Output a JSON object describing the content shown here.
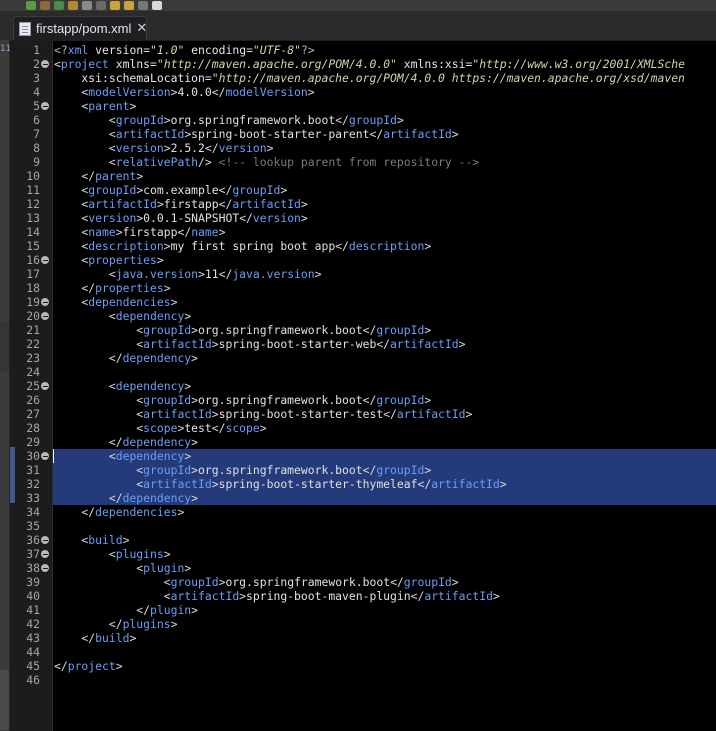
{
  "colors": {
    "editor_bg": "#000000",
    "tag": "#6c9ef5",
    "attr_value": "#cfd6a8",
    "comment": "#7a7a7a",
    "selection": "#253a7b",
    "gutter_bg": "#1c1c1c"
  },
  "tab": {
    "label": "firstapp/pom.xml",
    "close_glyph": "✕",
    "icon": "xml-file-icon"
  },
  "left_strip_mark": "11",
  "editor": {
    "lines": [
      {
        "n": "1",
        "fold": false,
        "sel": false,
        "tokens": [
          [
            "pi",
            "<?"
          ],
          [
            "t",
            "xml"
          ],
          [
            "a",
            " version"
          ],
          [
            "b",
            "="
          ],
          [
            "v",
            "\"1.0\""
          ],
          [
            "a",
            " encoding"
          ],
          [
            "b",
            "="
          ],
          [
            "v",
            "\"UTF-8\""
          ],
          [
            "pi",
            "?>"
          ]
        ]
      },
      {
        "n": "2",
        "fold": true,
        "sel": false,
        "tokens": [
          [
            "b",
            "<"
          ],
          [
            "t",
            "project"
          ],
          [
            "a",
            " xmlns"
          ],
          [
            "b",
            "="
          ],
          [
            "v",
            "\"http://maven.apache.org/POM/4.0.0\""
          ],
          [
            "a",
            " xmlns:xsi"
          ],
          [
            "b",
            "="
          ],
          [
            "v",
            "\"http://www.w3.org/2001/XMLSche"
          ]
        ]
      },
      {
        "n": "3",
        "fold": false,
        "sel": false,
        "tokens": [
          [
            "a",
            "    xsi:schemaLocation"
          ],
          [
            "b",
            "="
          ],
          [
            "v",
            "\"http://maven.apache.org/POM/4.0.0 https://maven.apache.org/xsd/maven"
          ]
        ]
      },
      {
        "n": "4",
        "fold": false,
        "sel": false,
        "tokens": [
          [
            "b",
            "    <"
          ],
          [
            "t",
            "modelVersion"
          ],
          [
            "b",
            ">"
          ],
          [
            "tx",
            "4.0.0"
          ],
          [
            "b",
            "</"
          ],
          [
            "t",
            "modelVersion"
          ],
          [
            "b",
            ">"
          ]
        ]
      },
      {
        "n": "5",
        "fold": true,
        "sel": false,
        "tokens": [
          [
            "b",
            "    <"
          ],
          [
            "t",
            "parent"
          ],
          [
            "b",
            ">"
          ]
        ]
      },
      {
        "n": "6",
        "fold": false,
        "sel": false,
        "tokens": [
          [
            "b",
            "        <"
          ],
          [
            "t",
            "groupId"
          ],
          [
            "b",
            ">"
          ],
          [
            "tx",
            "org.springframework.boot"
          ],
          [
            "b",
            "</"
          ],
          [
            "t",
            "groupId"
          ],
          [
            "b",
            ">"
          ]
        ]
      },
      {
        "n": "7",
        "fold": false,
        "sel": false,
        "tokens": [
          [
            "b",
            "        <"
          ],
          [
            "t",
            "artifactId"
          ],
          [
            "b",
            ">"
          ],
          [
            "tx",
            "spring-boot-starter-parent"
          ],
          [
            "b",
            "</"
          ],
          [
            "t",
            "artifactId"
          ],
          [
            "b",
            ">"
          ]
        ]
      },
      {
        "n": "8",
        "fold": false,
        "sel": false,
        "tokens": [
          [
            "b",
            "        <"
          ],
          [
            "t",
            "version"
          ],
          [
            "b",
            ">"
          ],
          [
            "tx",
            "2.5.2"
          ],
          [
            "b",
            "</"
          ],
          [
            "t",
            "version"
          ],
          [
            "b",
            ">"
          ]
        ]
      },
      {
        "n": "9",
        "fold": false,
        "sel": false,
        "tokens": [
          [
            "b",
            "        <"
          ],
          [
            "t",
            "relativePath"
          ],
          [
            "b",
            "/>"
          ],
          [
            "c",
            " <!-- lookup parent from repository -->"
          ]
        ]
      },
      {
        "n": "10",
        "fold": false,
        "sel": false,
        "tokens": [
          [
            "b",
            "    </"
          ],
          [
            "t",
            "parent"
          ],
          [
            "b",
            ">"
          ]
        ]
      },
      {
        "n": "11",
        "fold": false,
        "sel": false,
        "tokens": [
          [
            "b",
            "    <"
          ],
          [
            "t",
            "groupId"
          ],
          [
            "b",
            ">"
          ],
          [
            "tx",
            "com.example"
          ],
          [
            "b",
            "</"
          ],
          [
            "t",
            "groupId"
          ],
          [
            "b",
            ">"
          ]
        ]
      },
      {
        "n": "12",
        "fold": false,
        "sel": false,
        "tokens": [
          [
            "b",
            "    <"
          ],
          [
            "t",
            "artifactId"
          ],
          [
            "b",
            ">"
          ],
          [
            "tx",
            "firstapp"
          ],
          [
            "b",
            "</"
          ],
          [
            "t",
            "artifactId"
          ],
          [
            "b",
            ">"
          ]
        ]
      },
      {
        "n": "13",
        "fold": false,
        "sel": false,
        "tokens": [
          [
            "b",
            "    <"
          ],
          [
            "t",
            "version"
          ],
          [
            "b",
            ">"
          ],
          [
            "tx",
            "0.0.1-SNAPSHOT"
          ],
          [
            "b",
            "</"
          ],
          [
            "t",
            "version"
          ],
          [
            "b",
            ">"
          ]
        ]
      },
      {
        "n": "14",
        "fold": false,
        "sel": false,
        "tokens": [
          [
            "b",
            "    <"
          ],
          [
            "t",
            "name"
          ],
          [
            "b",
            ">"
          ],
          [
            "tx",
            "firstapp"
          ],
          [
            "b",
            "</"
          ],
          [
            "t",
            "name"
          ],
          [
            "b",
            ">"
          ]
        ]
      },
      {
        "n": "15",
        "fold": false,
        "sel": false,
        "tokens": [
          [
            "b",
            "    <"
          ],
          [
            "t",
            "description"
          ],
          [
            "b",
            ">"
          ],
          [
            "tx",
            "my first spring boot app"
          ],
          [
            "b",
            "</"
          ],
          [
            "t",
            "description"
          ],
          [
            "b",
            ">"
          ]
        ]
      },
      {
        "n": "16",
        "fold": true,
        "sel": false,
        "tokens": [
          [
            "b",
            "    <"
          ],
          [
            "t",
            "properties"
          ],
          [
            "b",
            ">"
          ]
        ]
      },
      {
        "n": "17",
        "fold": false,
        "sel": false,
        "tokens": [
          [
            "b",
            "        <"
          ],
          [
            "t",
            "java.version"
          ],
          [
            "b",
            ">"
          ],
          [
            "tx",
            "11"
          ],
          [
            "b",
            "</"
          ],
          [
            "t",
            "java.version"
          ],
          [
            "b",
            ">"
          ]
        ]
      },
      {
        "n": "18",
        "fold": false,
        "sel": false,
        "tokens": [
          [
            "b",
            "    </"
          ],
          [
            "t",
            "properties"
          ],
          [
            "b",
            ">"
          ]
        ]
      },
      {
        "n": "19",
        "fold": true,
        "sel": false,
        "tokens": [
          [
            "b",
            "    <"
          ],
          [
            "t",
            "dependencies"
          ],
          [
            "b",
            ">"
          ]
        ]
      },
      {
        "n": "20",
        "fold": true,
        "sel": false,
        "tokens": [
          [
            "b",
            "        <"
          ],
          [
            "t",
            "dependency"
          ],
          [
            "b",
            ">"
          ]
        ]
      },
      {
        "n": "21",
        "fold": false,
        "sel": false,
        "tokens": [
          [
            "b",
            "            <"
          ],
          [
            "t",
            "groupId"
          ],
          [
            "b",
            ">"
          ],
          [
            "tx",
            "org.springframework.boot"
          ],
          [
            "b",
            "</"
          ],
          [
            "t",
            "groupId"
          ],
          [
            "b",
            ">"
          ]
        ]
      },
      {
        "n": "22",
        "fold": false,
        "sel": false,
        "tokens": [
          [
            "b",
            "            <"
          ],
          [
            "t",
            "artifactId"
          ],
          [
            "b",
            ">"
          ],
          [
            "tx",
            "spring-boot-starter-web"
          ],
          [
            "b",
            "</"
          ],
          [
            "t",
            "artifactId"
          ],
          [
            "b",
            ">"
          ]
        ]
      },
      {
        "n": "23",
        "fold": false,
        "sel": false,
        "tokens": [
          [
            "b",
            "        </"
          ],
          [
            "t",
            "dependency"
          ],
          [
            "b",
            ">"
          ]
        ]
      },
      {
        "n": "24",
        "fold": false,
        "sel": false,
        "tokens": []
      },
      {
        "n": "25",
        "fold": true,
        "sel": false,
        "tokens": [
          [
            "b",
            "        <"
          ],
          [
            "t",
            "dependency"
          ],
          [
            "b",
            ">"
          ]
        ]
      },
      {
        "n": "26",
        "fold": false,
        "sel": false,
        "tokens": [
          [
            "b",
            "            <"
          ],
          [
            "t",
            "groupId"
          ],
          [
            "b",
            ">"
          ],
          [
            "tx",
            "org.springframework.boot"
          ],
          [
            "b",
            "</"
          ],
          [
            "t",
            "groupId"
          ],
          [
            "b",
            ">"
          ]
        ]
      },
      {
        "n": "27",
        "fold": false,
        "sel": false,
        "tokens": [
          [
            "b",
            "            <"
          ],
          [
            "t",
            "artifactId"
          ],
          [
            "b",
            ">"
          ],
          [
            "tx",
            "spring-boot-starter-test"
          ],
          [
            "b",
            "</"
          ],
          [
            "t",
            "artifactId"
          ],
          [
            "b",
            ">"
          ]
        ]
      },
      {
        "n": "28",
        "fold": false,
        "sel": false,
        "tokens": [
          [
            "b",
            "            <"
          ],
          [
            "t",
            "scope"
          ],
          [
            "b",
            ">"
          ],
          [
            "tx",
            "test"
          ],
          [
            "b",
            "</"
          ],
          [
            "t",
            "scope"
          ],
          [
            "b",
            ">"
          ]
        ]
      },
      {
        "n": "29",
        "fold": false,
        "sel": false,
        "tokens": [
          [
            "b",
            "        </"
          ],
          [
            "t",
            "dependency"
          ],
          [
            "b",
            ">"
          ]
        ]
      },
      {
        "n": "30",
        "fold": true,
        "sel": true,
        "caret": true,
        "tokens": [
          [
            "b",
            "        <"
          ],
          [
            "t",
            "dependency"
          ],
          [
            "b",
            ">"
          ]
        ]
      },
      {
        "n": "31",
        "fold": false,
        "sel": true,
        "tokens": [
          [
            "b",
            "            <"
          ],
          [
            "t",
            "groupId"
          ],
          [
            "b",
            ">"
          ],
          [
            "tx",
            "org.springframework.boot"
          ],
          [
            "b",
            "</"
          ],
          [
            "t",
            "groupId"
          ],
          [
            "b",
            ">"
          ]
        ]
      },
      {
        "n": "32",
        "fold": false,
        "sel": true,
        "tokens": [
          [
            "b",
            "            <"
          ],
          [
            "t",
            "artifactId"
          ],
          [
            "b",
            ">"
          ],
          [
            "tx",
            "spring-boot-starter-thymeleaf"
          ],
          [
            "b",
            "</"
          ],
          [
            "t",
            "artifactId"
          ],
          [
            "b",
            ">"
          ]
        ]
      },
      {
        "n": "33",
        "fold": false,
        "sel": true,
        "tokens": [
          [
            "b",
            "        </"
          ],
          [
            "t",
            "dependency"
          ],
          [
            "b",
            ">"
          ]
        ]
      },
      {
        "n": "34",
        "fold": false,
        "sel": false,
        "tokens": [
          [
            "b",
            "    </"
          ],
          [
            "t",
            "dependencies"
          ],
          [
            "b",
            ">"
          ]
        ]
      },
      {
        "n": "35",
        "fold": false,
        "sel": false,
        "tokens": []
      },
      {
        "n": "36",
        "fold": true,
        "sel": false,
        "tokens": [
          [
            "b",
            "    <"
          ],
          [
            "t",
            "build"
          ],
          [
            "b",
            ">"
          ]
        ]
      },
      {
        "n": "37",
        "fold": true,
        "sel": false,
        "tokens": [
          [
            "b",
            "        <"
          ],
          [
            "t",
            "plugins"
          ],
          [
            "b",
            ">"
          ]
        ]
      },
      {
        "n": "38",
        "fold": true,
        "sel": false,
        "tokens": [
          [
            "b",
            "            <"
          ],
          [
            "t",
            "plugin"
          ],
          [
            "b",
            ">"
          ]
        ]
      },
      {
        "n": "39",
        "fold": false,
        "sel": false,
        "tokens": [
          [
            "b",
            "                <"
          ],
          [
            "t",
            "groupId"
          ],
          [
            "b",
            ">"
          ],
          [
            "tx",
            "org.springframework.boot"
          ],
          [
            "b",
            "</"
          ],
          [
            "t",
            "groupId"
          ],
          [
            "b",
            ">"
          ]
        ]
      },
      {
        "n": "40",
        "fold": false,
        "sel": false,
        "tokens": [
          [
            "b",
            "                <"
          ],
          [
            "t",
            "artifactId"
          ],
          [
            "b",
            ">"
          ],
          [
            "tx",
            "spring-boot-maven-plugin"
          ],
          [
            "b",
            "</"
          ],
          [
            "t",
            "artifactId"
          ],
          [
            "b",
            ">"
          ]
        ]
      },
      {
        "n": "41",
        "fold": false,
        "sel": false,
        "tokens": [
          [
            "b",
            "            </"
          ],
          [
            "t",
            "plugin"
          ],
          [
            "b",
            ">"
          ]
        ]
      },
      {
        "n": "42",
        "fold": false,
        "sel": false,
        "tokens": [
          [
            "b",
            "        </"
          ],
          [
            "t",
            "plugins"
          ],
          [
            "b",
            ">"
          ]
        ]
      },
      {
        "n": "43",
        "fold": false,
        "sel": false,
        "tokens": [
          [
            "b",
            "    </"
          ],
          [
            "t",
            "build"
          ],
          [
            "b",
            ">"
          ]
        ]
      },
      {
        "n": "44",
        "fold": false,
        "sel": false,
        "tokens": []
      },
      {
        "n": "45",
        "fold": false,
        "sel": false,
        "tokens": [
          [
            "b",
            "</"
          ],
          [
            "t",
            "project"
          ],
          [
            "b",
            ">"
          ]
        ]
      },
      {
        "n": "46",
        "fold": false,
        "sel": false,
        "tokens": []
      }
    ]
  }
}
